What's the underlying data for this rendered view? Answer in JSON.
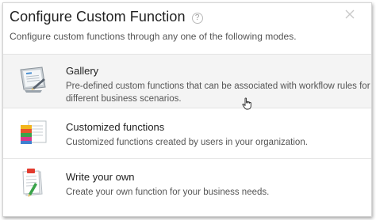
{
  "dialog": {
    "title": "Configure Custom Function",
    "help_glyph": "?",
    "subtitle": "Configure custom functions through any one of the following modes."
  },
  "options": [
    {
      "title": "Gallery",
      "description": "Pre-defined custom functions that can be associated with workflow rules for different business scenarios.",
      "icon": "gallery-icon"
    },
    {
      "title": "Customized functions",
      "description": "Customized functions created by users in your organization.",
      "icon": "customized-functions-icon"
    },
    {
      "title": "Write your own",
      "description": "Create your own function for your business needs.",
      "icon": "write-your-own-icon"
    }
  ],
  "colors": {
    "highlight_row": "#f4f4f4",
    "divider": "#e4e4e4",
    "title_text": "#222222",
    "muted_text": "#555555"
  }
}
